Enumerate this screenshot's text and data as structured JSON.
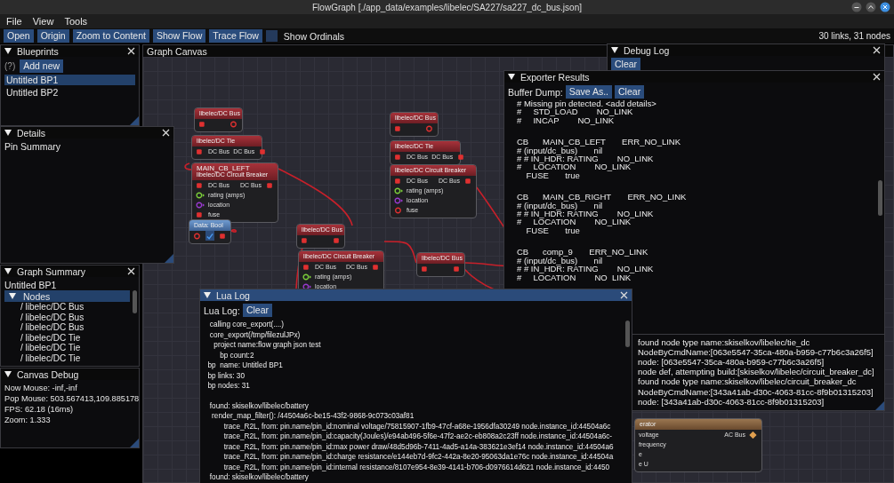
{
  "window": {
    "title": "FlowGraph [./app_data/examples/libelec/SA227/sa227_dc_bus.json]"
  },
  "menu": [
    "File",
    "View",
    "Tools"
  ],
  "toolbar": {
    "buttons": [
      "Open",
      "Origin",
      "Zoom to Content",
      "Show Flow",
      "Trace Flow"
    ],
    "show_ordinals": {
      "label": "Show Ordinals",
      "checked": false
    },
    "stats": "30 links, 31 nodes"
  },
  "blueprints": {
    "title": "Blueprints",
    "help": "(?)",
    "add_button": "Add new",
    "items": [
      {
        "label": "Untitled BP1",
        "selected": true
      },
      {
        "label": "Untitled BP2",
        "selected": false
      }
    ]
  },
  "details": {
    "title": "Details",
    "heading": "Pin Summary"
  },
  "graph_summary": {
    "title": "Graph Summary",
    "blueprint": "Untitled BP1",
    "tree": {
      "label": "Nodes",
      "expanded": true,
      "children": [
        "/ libelec/DC Bus",
        "/ libelec/DC Bus",
        "/ libelec/DC Bus",
        "/ libelec/DC Tie",
        "/ libelec/DC Tie",
        "/ libelec/DC Tie"
      ]
    }
  },
  "canvas_debug": {
    "title": "Canvas Debug",
    "lines": [
      "Now Mouse: -inf,-inf",
      "Pop Mouse: 503.567413,109.885178",
      "FPS: 62.18 (16ms)",
      "Zoom: 1.333"
    ]
  },
  "graph_canvas": {
    "title": "Graph Canvas",
    "nodes": [
      {
        "kind": "elec",
        "title": "libelec/DC Bus",
        "rows": [
          {
            "left": {
              "kind": "power",
              "connected": true
            },
            "right": {
              "kind": "power",
              "connected": false
            }
          }
        ]
      },
      {
        "kind": "elec",
        "title": "libelec/DC Tie",
        "rows": [
          {
            "left": {
              "label": "DC Bus",
              "kind": "power",
              "connected": true
            },
            "right": {
              "label": "DC Bus",
              "kind": "power",
              "connected": true
            }
          }
        ]
      },
      {
        "kind": "elec",
        "name": "MAIN_CB_LEFT",
        "title": "libelec/DC Circuit Breaker",
        "rows": [
          {
            "left": {
              "label": "DC Bus",
              "kind": "power",
              "connected": true
            },
            "right": {
              "label": "DC Bus",
              "kind": "power",
              "connected": true
            }
          },
          {
            "left": {
              "label": "rating (amps)",
              "kind": "number",
              "connected": false
            }
          },
          {
            "left": {
              "label": "location",
              "kind": "text",
              "connected": false
            }
          },
          {
            "left": {
              "label": "fuse",
              "kind": "power",
              "connected": true
            }
          }
        ]
      },
      {
        "kind": "data",
        "title": "Data: Bool",
        "checked": true,
        "rows": [
          {
            "left": {
              "kind": "power",
              "connected": false
            },
            "right": {
              "kind": "power",
              "connected": true
            }
          }
        ]
      },
      {
        "kind": "elec",
        "title": "libelec/DC Bus",
        "rows": [
          {
            "left": {
              "kind": "power",
              "connected": true
            },
            "right": {
              "kind": "power",
              "connected": false
            }
          }
        ]
      },
      {
        "kind": "elec",
        "title": "libelec/DC Tie",
        "rows": [
          {
            "left": {
              "label": "DC Bus",
              "kind": "power",
              "connected": true
            },
            "right": {
              "label": "DC Bus",
              "kind": "power",
              "connected": true
            }
          }
        ]
      },
      {
        "kind": "elec",
        "title": "libelec/DC Circuit Breaker",
        "rows": [
          {
            "left": {
              "label": "DC Bus",
              "kind": "power",
              "connected": true
            },
            "right": {
              "label": "DC Bus",
              "kind": "power",
              "connected": true
            }
          },
          {
            "left": {
              "label": "rating (amps)",
              "kind": "number",
              "connected": false
            }
          },
          {
            "left": {
              "label": "location",
              "kind": "text",
              "connected": false
            }
          },
          {
            "left": {
              "label": "fuse",
              "kind": "power",
              "connected": false
            }
          }
        ]
      },
      {
        "kind": "elec",
        "title": "libelec/DC Bus",
        "rows": [
          {
            "left": {
              "kind": "power",
              "connected": true
            },
            "right": {
              "kind": "power",
              "connected": true
            }
          }
        ]
      },
      {
        "kind": "elec",
        "title": "libelec/DC Circuit Breaker",
        "rows": [
          {
            "left": {
              "label": "DC Bus",
              "kind": "power",
              "connected": true
            },
            "right": {
              "label": "DC Bus",
              "kind": "power",
              "connected": true
            }
          },
          {
            "left": {
              "label": "rating (amps)",
              "kind": "number",
              "connected": false
            }
          },
          {
            "left": {
              "label": "location",
              "kind": "text",
              "connected": false
            }
          }
        ]
      },
      {
        "kind": "elec",
        "title": "libelec/DC Bus",
        "rows": [
          {
            "left": {
              "kind": "power",
              "connected": true
            },
            "right": {
              "kind": "power",
              "connected": true
            }
          }
        ]
      },
      {
        "kind": "gen",
        "title": "erator",
        "rows": [
          {
            "left": {
              "label": "voltage"
            },
            "right": {
              "label": "AC Bus",
              "kind": "ac",
              "connected": true
            }
          },
          {
            "left": {
              "label": "frequency"
            }
          },
          {
            "left": {
              "label": "e"
            }
          },
          {
            "left": {
              "label": "e U"
            }
          }
        ]
      }
    ]
  },
  "debug_log": {
    "title": "Debug Log",
    "clear_button": "Clear",
    "lines": [
      "found node type name:skiselkov/libelec/tie_dc",
      "NodeByCmdName:[063e5547-35ca-480a-b959-c77b6c3a26f5]",
      "node: [063e5547-35ca-480a-b959-c77b6c3a26f5]",
      "node def, attempting build:[skiselkov/libelec/circuit_breaker_dc]",
      "found node type name:skiselkov/libelec/circuit_breaker_dc",
      "NodeByCmdName:[343a41ab-d30c-4063-81cc-8f9b01315203]",
      "node: [343a41ab-d30c-4063-81cc-8f9b01315203]"
    ]
  },
  "exporter_results": {
    "title": "Exporter Results",
    "label": "Buffer Dump:",
    "buttons": [
      "Save As..",
      "Clear"
    ],
    "blocks": [
      [
        "# Missing pin detected. <add details>",
        "#     STD_LOAD        NO_LINK",
        "#     INCAP        NO_LINK"
      ],
      [
        "CB      MAIN_CB_LEFT       ERR_NO_LINK",
        "# (input/dc_bus)       nil",
        "# # IN_HDR: RATING        NO_LINK",
        "#     LOCATION        NO_LINK",
        "    FUSE       true"
      ],
      [
        "CB      MAIN_CB_RIGHT       ERR_NO_LINK",
        "# (input/dc_bus)       nil",
        "# # IN_HDR: RATING        NO_LINK",
        "#     LOCATION        NO_LINK",
        "    FUSE       true"
      ],
      [
        "CB      comp_9       ERR_NO_LINK",
        "# (input/dc_bus)       nil",
        "# # IN_HDR: RATING        NO_LINK",
        "#     LOCATION        NO_LINK"
      ]
    ]
  },
  "lua_log": {
    "title": "Lua Log",
    "focused": true,
    "label": "Lua Log:",
    "clear_button": "Clear",
    "groups": [
      [
        "   calling core_export(....)",
        "   core_export(/tmp/filezulJPx)",
        "     project name:flow graph json test",
        "        bp count:2",
        "  bp  name: Untitled BP1",
        "  bp links: 30",
        "  bp nodes: 31"
      ],
      [
        "   found: skiselkov/libelec/battery",
        "    render_map_filter(): /44504a6c-be15-43f2-9868-9c073c03af81",
        "          trace_R2L, from: pin.name/pin_id:nominal voltage/75815907-1fb9-47cf-a68e-1956dfa30249 node.instance_id:44504a6c",
        "          trace_R2L, from: pin.name/pin_id:capacity(Joules)/e94ab496-5f6e-47f2-ae2c-eb808a2c23ff node.instance_id:44504a6c-",
        "          trace_R2L, from: pin.name/pin_id:max power draw/48d5d96b-7411-4ad5-a14a-383621e3ef14 node.instance_id:44504a6",
        "          trace_R2L, from: pin.name/pin_id:charge resistance/e144eb7d-9fc2-442a-8e20-95063da1e76c node.instance_id:44504a",
        "          trace_R2L, from: pin.name/pin_id:internal resistance/8107e954-8e39-4141-b706-d0976614d621 node.instance_id:4450",
        "   found: skiselkov/libelec/battery"
      ]
    ]
  }
}
